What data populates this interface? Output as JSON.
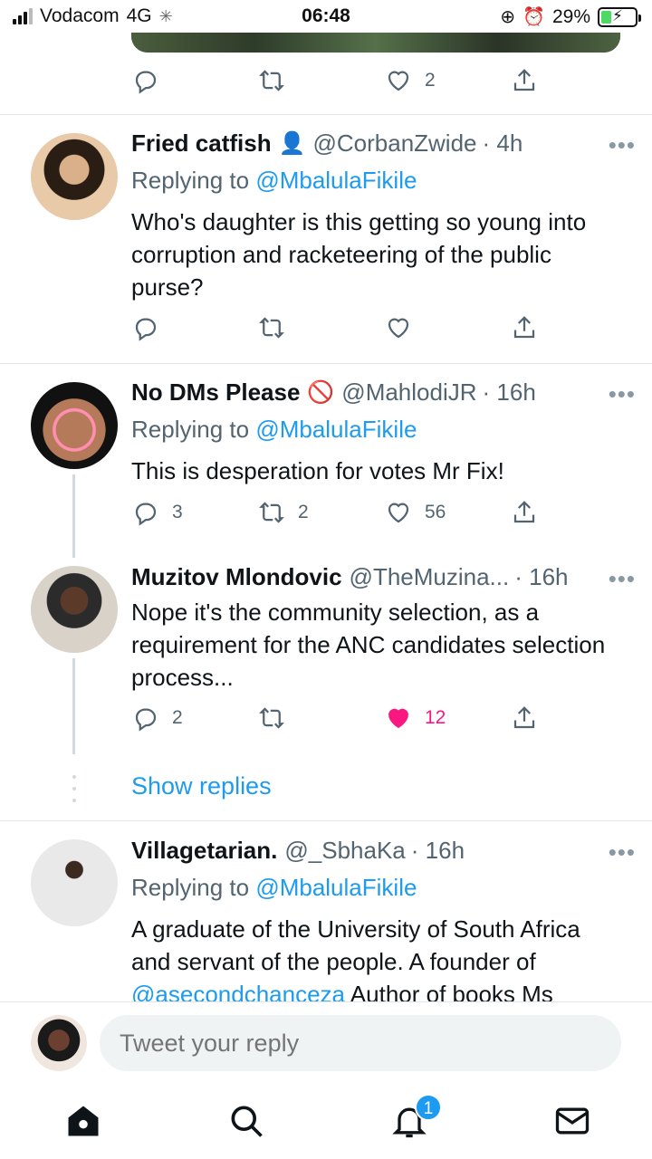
{
  "status_bar": {
    "carrier": "Vodacom",
    "network": "4G",
    "time": "06:48",
    "battery": "29%"
  },
  "top_tweet_actions": {
    "reply_count": "",
    "retweet_count": "",
    "like_count": "2"
  },
  "tweets": [
    {
      "name": "Fried catfish",
      "badge_emoji": "👤",
      "handle": "@CorbanZwide",
      "time": "· 4h",
      "replying_prefix": "Replying to ",
      "replying_to": "@MbalulaFikile",
      "text": "Who's daughter is this getting so young into corruption and racketeering of the public purse?",
      "reply_count": "",
      "retweet_count": "",
      "like_count": ""
    },
    {
      "name": "No DMs Please",
      "badge_emoji": "🚫",
      "handle": "@MahlodiJR",
      "time": "· 16h",
      "replying_prefix": "Replying to ",
      "replying_to": "@MbalulaFikile",
      "text": "This is desperation for votes Mr Fix!",
      "reply_count": "3",
      "retweet_count": "2",
      "like_count": "56"
    },
    {
      "name": "Muzitov Mlondovic",
      "handle": "@TheMuzina...",
      "time": "· 16h",
      "text": "Nope it's the community selection, as a requirement for the ANC candidates selection process...",
      "reply_count": "2",
      "retweet_count": "",
      "like_count": "12"
    },
    {
      "name": "Villagetarian.",
      "handle": "@_SbhaKa",
      "time": "· 16h",
      "replying_prefix": "Replying to ",
      "replying_to": "@MbalulaFikile",
      "text_line1": "A graduate of the University of South Africa",
      "text_line2": "and servant of the people. A founder of",
      "text_link": "@asecondchanceza",
      "text_line3_rest": " Author of books Ms"
    }
  ],
  "show_replies": "Show replies",
  "more_glyph": "•••",
  "reply_bar": {
    "placeholder": "Tweet your reply"
  },
  "tab_bar": {
    "notification_badge": "1"
  },
  "colors": {
    "accent": "#1d9bf0",
    "like_active": "#f91880",
    "muted": "#536471"
  }
}
